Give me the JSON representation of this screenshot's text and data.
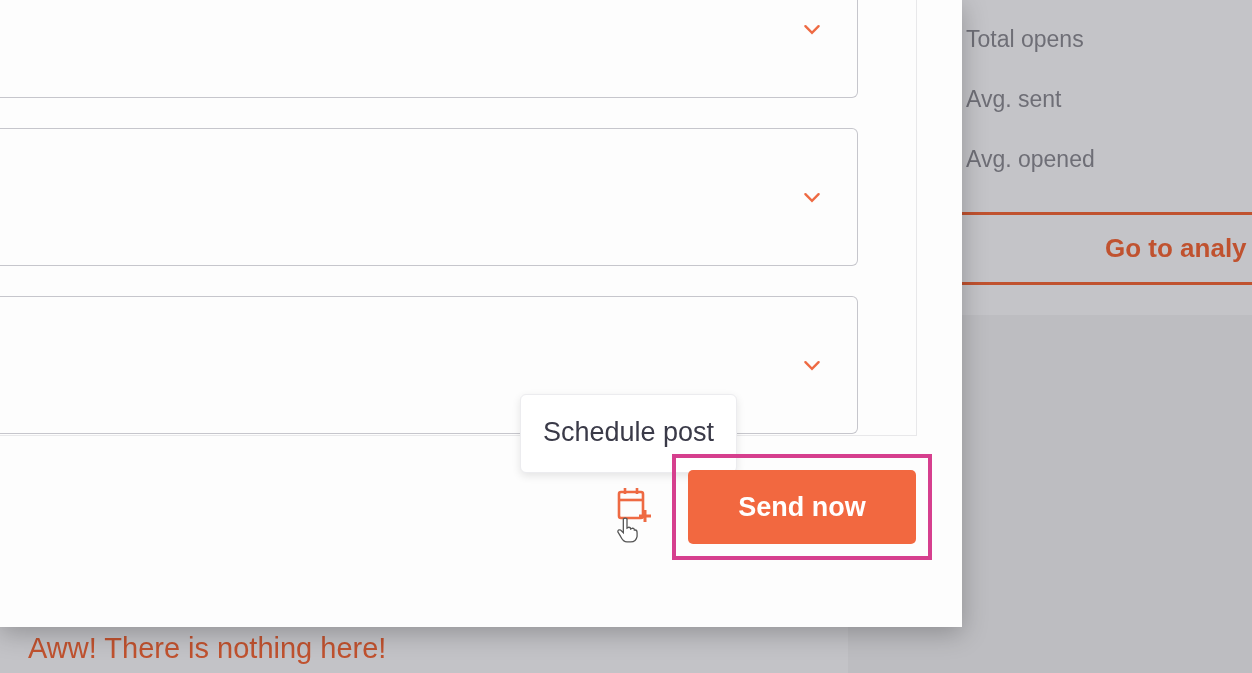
{
  "background_page": {
    "stats_labels": [
      "Total opens",
      "Avg. sent",
      "Avg. opened"
    ],
    "analytics_link": "Go to analy",
    "empty_message": "Aww! There is nothing here!"
  },
  "dialog": {
    "dropdowns": [
      {
        "expanded": false
      },
      {
        "expanded": false
      },
      {
        "expanded": false
      }
    ],
    "tooltip": "Schedule post",
    "send_button": {
      "label": "Send now",
      "highlighted": true
    }
  }
}
